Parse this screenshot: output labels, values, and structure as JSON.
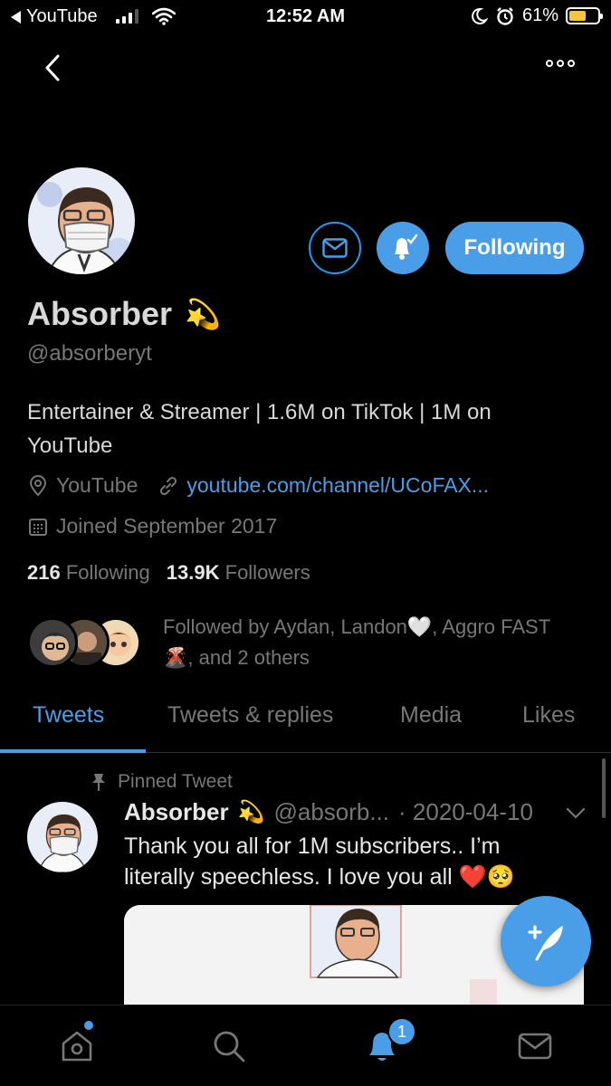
{
  "status_bar": {
    "back_app": "YouTube",
    "time": "12:52 AM",
    "battery_pct": "61%",
    "battery_level": 0.61
  },
  "profile": {
    "display_name": "Absorber",
    "name_emoji": "💫",
    "handle": "@absorberyt",
    "bio": "Entertainer & Streamer | 1.6M on TikTok | 1M on YouTube",
    "location": "YouTube",
    "link": "youtube.com/channel/UCoFAX...",
    "joined": "Joined September 2017",
    "following_count": "216",
    "following_label": "Following",
    "followers_count": "13.9K",
    "followers_label": "Followers",
    "followed_by": "Followed by Aydan, Landon🤍, Aggro FAST 🌋, and 2 others",
    "follow_button": "Following"
  },
  "tabs": [
    {
      "label": "Tweets",
      "active": true
    },
    {
      "label": "Tweets & replies",
      "active": false
    },
    {
      "label": "Media",
      "active": false
    },
    {
      "label": "Likes",
      "active": false
    }
  ],
  "tweet": {
    "pinned_label": "Pinned Tweet",
    "name": "Absorber",
    "name_emoji": "💫",
    "handle": "@absorb...",
    "date": "· 2020-04-10",
    "text": "Thank you all for 1M subscribers.. I’m literally speechless. I love you all ❤️🥺"
  },
  "bottom_nav": {
    "notification_badge": "1",
    "icons": [
      "home-icon",
      "search-icon",
      "bell-icon",
      "mail-icon"
    ]
  },
  "colors": {
    "accent": "#4a9ee8",
    "background": "#000000",
    "muted": "#777777"
  }
}
